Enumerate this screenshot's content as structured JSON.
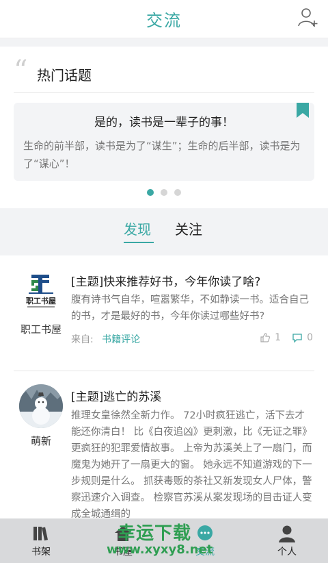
{
  "header": {
    "title": "交流",
    "add_user_icon": "add-user-icon"
  },
  "hot_topics": {
    "label": "热门话题",
    "card": {
      "title": "是的，读书是一辈子的事！",
      "text": "生命的前半部，读书是为了“谋生”；生命的后半部，读书是为了“谋心”！"
    },
    "pagination": {
      "total": 3,
      "active": 1
    }
  },
  "tabs": [
    {
      "label": "发现",
      "active": true
    },
    {
      "label": "关注",
      "active": false
    }
  ],
  "posts": [
    {
      "author": "职工书屋",
      "logo_text": "职工书屋",
      "title": "[主题]快来推荐好书，今年你读了啥?",
      "body": "腹有诗书气自华，喧嚣繁华，不如静读一书。适合自己的书，才是最好的书，今年你读过哪些好书?",
      "source_label": "来自:",
      "source": "书籍评论",
      "likes": "1",
      "comments": "0"
    },
    {
      "author": "萌新",
      "title": "[主题]逃亡的苏溪",
      "body": "推理女皇徐然全新力作。 72小时疯狂逃亡，活下去才能还你清白！ 比《白夜追凶》更刺激，比《无证之罪》更疯狂的犯罪爱情故事。 上帝为苏溪关上了一扇门，而魔鬼为她开了一扇更大的窗。 她永远不知道游戏的下一步规则是什么。 抓获毒贩的茶社又新发现女人尸体，警察迅速介入调查。 检察官苏溪从案发现场的目击证人变成全城通缉的"
    }
  ],
  "bottom_nav": [
    {
      "label": "书架",
      "icon": "bookshelf-icon"
    },
    {
      "label": "书屋",
      "icon": "house-icon"
    },
    {
      "label": "交流",
      "icon": "chat-icon"
    },
    {
      "label": "个人",
      "icon": "person-icon"
    }
  ],
  "watermark": {
    "text": "幸运下载",
    "url": "www.xyxy8.net"
  },
  "colors": {
    "accent": "#3aa8a4",
    "nav_bg": "#d8d9db",
    "watermark": "#2f9e52"
  }
}
